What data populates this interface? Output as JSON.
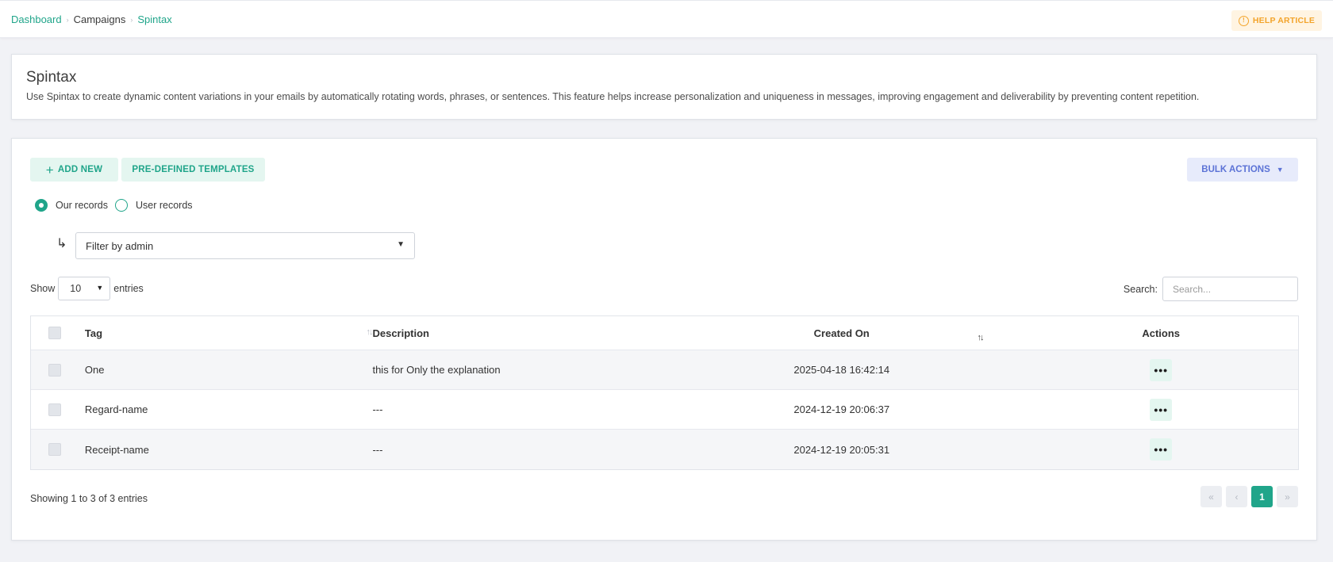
{
  "breadcrumb": {
    "home": "Dashboard",
    "parent": "Campaigns",
    "current": "Spintax"
  },
  "help": {
    "label": "HELP ARTICLE",
    "icon": "info-icon"
  },
  "info": {
    "title": "Spintax",
    "description": "Use Spintax to create dynamic content variations in your emails by automatically rotating words, phrases, or sentences. This feature helps increase personalization and uniqueness in messages, improving engagement and deliverability by preventing content repetition."
  },
  "toolbar": {
    "add_new": "ADD NEW",
    "templates": "PRE-DEFINED TEMPLATES",
    "bulk_actions": "BULK ACTIONS"
  },
  "records": {
    "ours": "Our records",
    "users": "User records",
    "selected": "ours"
  },
  "filter": {
    "value": "Filter by admin"
  },
  "length": {
    "show": "Show",
    "value": "10",
    "entries": "entries"
  },
  "search": {
    "label": "Search:",
    "placeholder": "Search..."
  },
  "table": {
    "headers": {
      "tag": "Tag",
      "description": "Description",
      "created": "Created On",
      "actions": "Actions"
    },
    "rows": [
      {
        "tag": "One",
        "description": "this for Only the explanation",
        "created": "2025-04-18 16:42:14"
      },
      {
        "tag": "Regard-name",
        "description": "---",
        "created": "2024-12-19 20:06:37"
      },
      {
        "tag": "Receipt-name",
        "description": "---",
        "created": "2024-12-19 20:05:31"
      }
    ]
  },
  "footer": {
    "info": "Showing 1 to 3 of 3 entries",
    "current_page": "1"
  },
  "colors": {
    "brand": "#20a58a",
    "help": "#f3a42b",
    "bulk": "#5c73d6"
  }
}
